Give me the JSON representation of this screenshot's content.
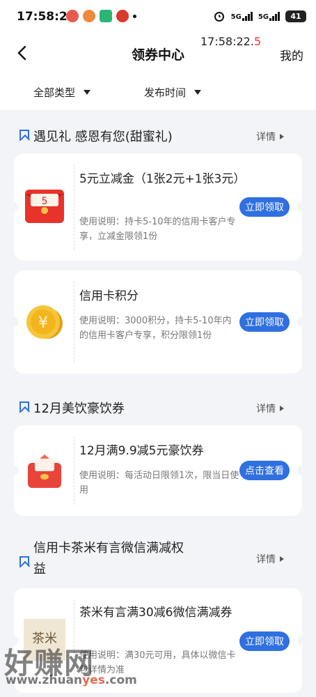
{
  "status": {
    "time": "17:58:23",
    "net1": "5G",
    "net2": "5G",
    "battery": "41"
  },
  "header": {
    "title": "领券中心",
    "clock_main": "17:58:22.",
    "clock_tenth": "5",
    "mine": "我的"
  },
  "filters": {
    "type": "全部类型",
    "time": "发布时间"
  },
  "sections": [
    {
      "title": "遇见礼 感恩有您(甜蜜礼)",
      "detail": "详情",
      "cards": [
        {
          "title": "5元立减金（1张2元+1张3元）",
          "desc": "使用说明：持卡5-10年的信用卡客户专享，立减金限领1份",
          "button": "立即领取",
          "icon": "red-envelope-icon",
          "icon_text": "5"
        },
        {
          "title": "信用卡积分",
          "desc": "使用说明：3000积分，持卡5-10年内的信用卡客户专享，积分限领1份",
          "button": "立即领取",
          "icon": "gold-coin-icon",
          "icon_text": "¥"
        }
      ]
    },
    {
      "title": "12月美饮豪饮券",
      "detail": "详情",
      "cards": [
        {
          "title": "12月满9.9减5元豪饮券",
          "desc": "使用说明：每活动日限领1次，限当日使用",
          "button": "点击查看",
          "icon": "red-coupon-icon"
        }
      ]
    },
    {
      "title": "信用卡茶米有言微信满减权益",
      "detail": "详情",
      "cards": [
        {
          "title": "茶米有言满30减6微信满减券",
          "desc": "使用说明：满30元可用，具体以微信卡包详情为准",
          "button": "立即领取",
          "icon": "tea-brand-icon",
          "icon_text": "茶米"
        }
      ]
    }
  ],
  "watermark": {
    "text": "好赚网",
    "url_a": "www.zhuan",
    "url_b": "yes",
    "url_c": ".com"
  },
  "colors": {
    "accent": "#2f6fe0",
    "red": "#e33"
  }
}
